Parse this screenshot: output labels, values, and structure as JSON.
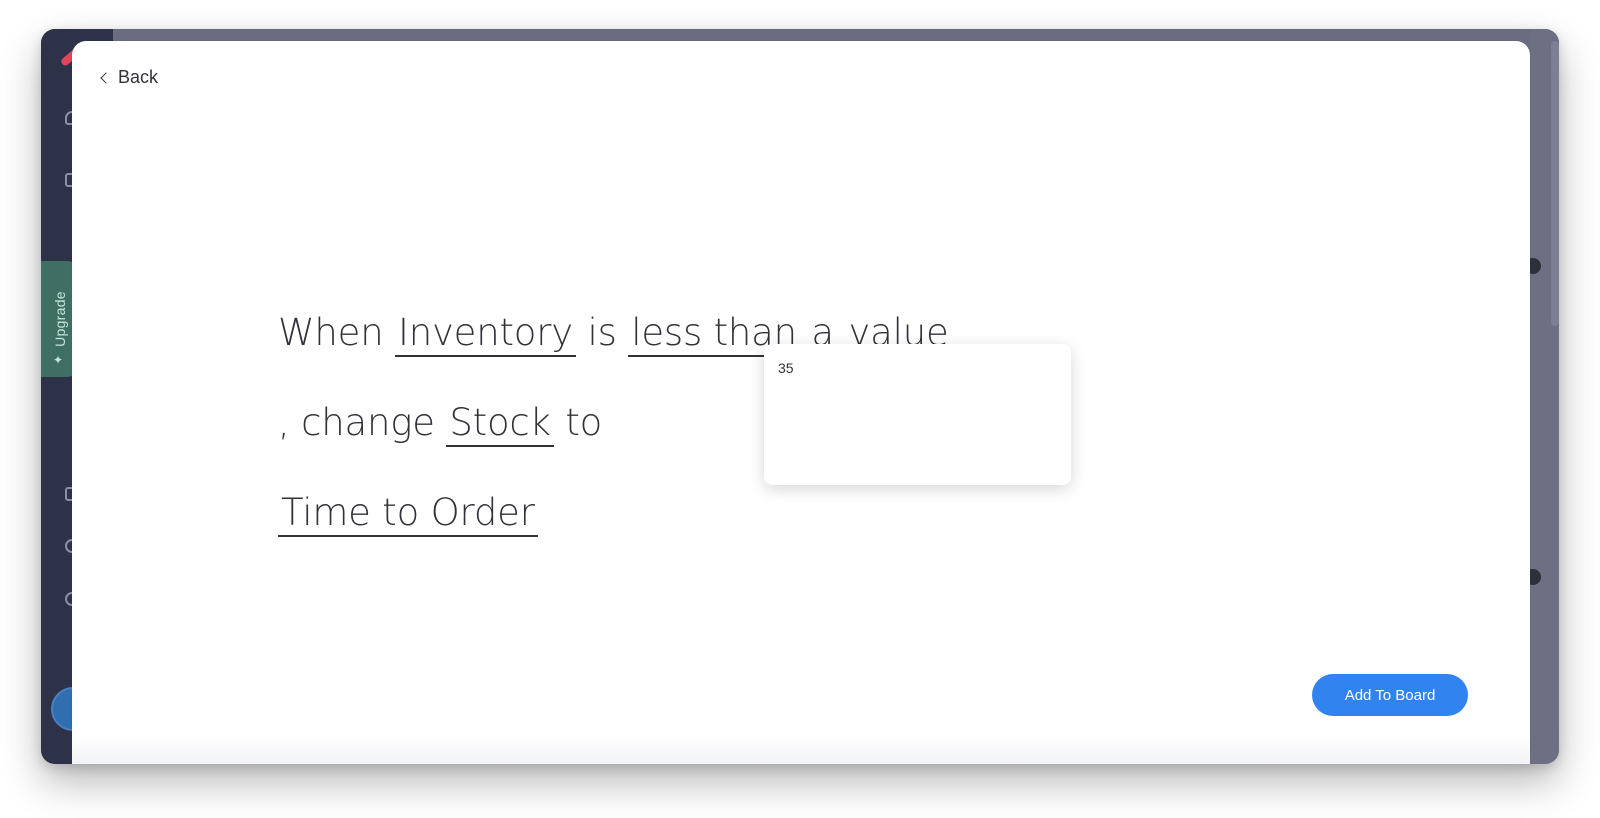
{
  "sidebar": {
    "upgrade_label": "Upgrade"
  },
  "modal": {
    "back_label": "Back",
    "recipe": {
      "when": "When ",
      "trigger_column": "Inventory",
      "is": " is ",
      "condition": "less than",
      "a": " a ",
      "value_field": "value",
      "comma_change": ", change ",
      "target_column": "Stock",
      "to": " to ",
      "new_status": "Time to Order"
    },
    "value_popover": {
      "value": "35"
    },
    "add_button_label": "Add To Board"
  },
  "colors": {
    "primary": "#3184f0",
    "sidebar_bg": "#2e3249",
    "upgrade_bg": "#3f6f62",
    "text": "#323338"
  }
}
